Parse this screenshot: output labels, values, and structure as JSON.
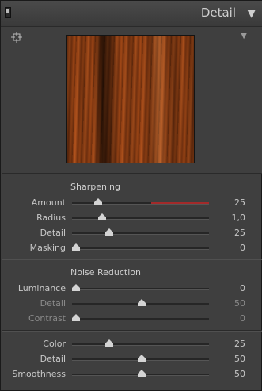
{
  "header": {
    "title": "Detail"
  },
  "sections": {
    "sharpening": {
      "title": "Sharpening",
      "sliders": [
        {
          "label": "Amount",
          "value": "25",
          "pos": 0.19
        },
        {
          "label": "Radius",
          "value": "1,0",
          "pos": 0.22
        },
        {
          "label": "Detail",
          "value": "25",
          "pos": 0.27
        },
        {
          "label": "Masking",
          "value": "0",
          "pos": 0.03
        }
      ]
    },
    "noise": {
      "title": "Noise Reduction",
      "sliders": [
        {
          "label": "Luminance",
          "value": "0",
          "pos": 0.03
        },
        {
          "label": "Detail",
          "value": "50",
          "pos": 0.51
        },
        {
          "label": "Contrast",
          "value": "0",
          "pos": 0.03
        }
      ]
    },
    "color": {
      "sliders": [
        {
          "label": "Color",
          "value": "25",
          "pos": 0.27
        },
        {
          "label": "Detail",
          "value": "50",
          "pos": 0.51
        },
        {
          "label": "Smoothness",
          "value": "50",
          "pos": 0.51
        }
      ]
    }
  },
  "icons": {
    "target": "target-adjust-icon",
    "preview_menu": "triangle-down-icon",
    "panel_collapse": "triangle-down-icon"
  },
  "colors": {
    "panel": "#3f3f3f",
    "header": "#404040",
    "text": "#cfcfcf",
    "accent": "#a32a2a"
  }
}
